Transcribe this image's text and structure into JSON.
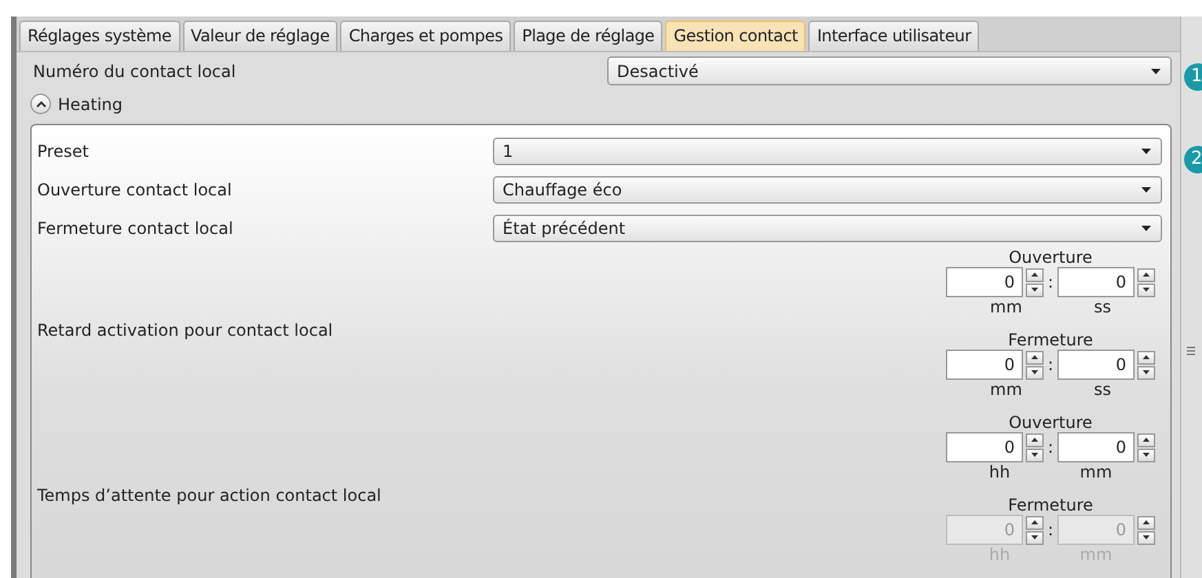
{
  "tabs": [
    {
      "label": "Réglages système",
      "selected": false
    },
    {
      "label": "Valeur de réglage",
      "selected": false
    },
    {
      "label": "Charges et pompes",
      "selected": false
    },
    {
      "label": "Plage de réglage",
      "selected": false
    },
    {
      "label": "Gestion contact",
      "selected": true
    },
    {
      "label": "Interface utilisateur",
      "selected": false
    }
  ],
  "contact_number": {
    "label": "Numéro du contact local",
    "value": "Desactivé"
  },
  "section": {
    "title": "Heating",
    "expanded": true
  },
  "fields": [
    {
      "label": "Preset",
      "value": "1"
    },
    {
      "label": "Ouverture contact local",
      "value": "Chauffage éco"
    },
    {
      "label": "Fermeture contact local",
      "value": "État précédent"
    }
  ],
  "delays": [
    {
      "label": "Retard activation pour contact local",
      "groups": [
        {
          "title": "Ouverture",
          "disabled": false,
          "separator": ":",
          "fields": [
            {
              "value": "0",
              "unit": "mm"
            },
            {
              "value": "0",
              "unit": "ss"
            }
          ]
        },
        {
          "title": "Fermeture",
          "disabled": false,
          "separator": ":",
          "fields": [
            {
              "value": "0",
              "unit": "mm"
            },
            {
              "value": "0",
              "unit": "ss"
            }
          ]
        }
      ]
    },
    {
      "label": "Temps d’attente pour action contact local",
      "groups": [
        {
          "title": "Ouverture",
          "disabled": false,
          "separator": ":",
          "fields": [
            {
              "value": "0",
              "unit": "hh"
            },
            {
              "value": "0",
              "unit": "mm"
            }
          ]
        },
        {
          "title": "Fermeture",
          "disabled": true,
          "separator": ":",
          "fields": [
            {
              "value": "0",
              "unit": "hh"
            },
            {
              "value": "0",
              "unit": "mm"
            }
          ]
        }
      ]
    }
  ],
  "callouts": [
    "1",
    "2"
  ]
}
